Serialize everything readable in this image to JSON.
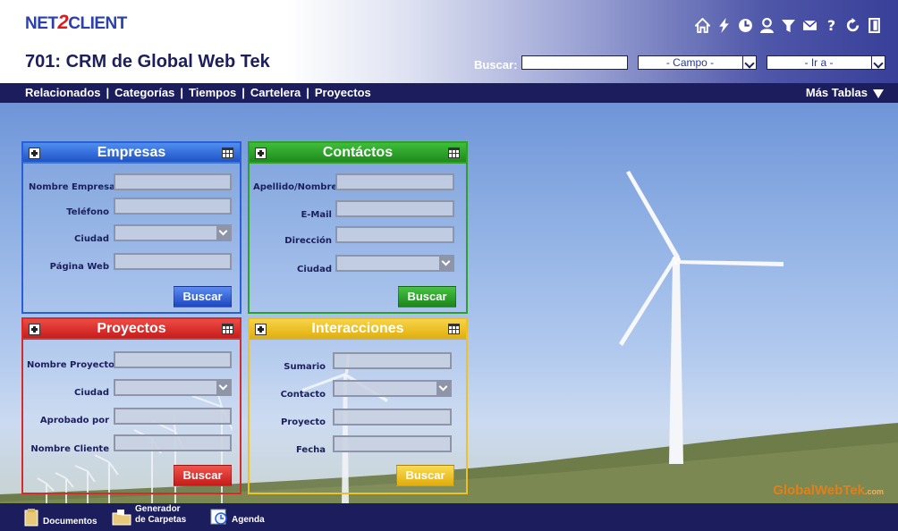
{
  "header": {
    "logo": {
      "part1": "NET",
      "part2": "2",
      "part3": "CLIENT"
    },
    "title": "701: CRM de Global Web Tek",
    "search_label": "Buscar:",
    "search_value": "",
    "campo_select": "- Campo -",
    "ira_select": "- Ir a -",
    "icons": [
      "home-icon",
      "bolt-icon",
      "clock-icon",
      "user-icon",
      "filter-icon",
      "mail-icon",
      "help-icon",
      "refresh-icon",
      "logout-icon"
    ]
  },
  "nav": {
    "links": [
      "Relacionados",
      "Categorías",
      "Tiempos",
      "Cartelera",
      "Proyectos"
    ],
    "more": "Más Tablas"
  },
  "panels": {
    "empresas": {
      "title": "Empresas",
      "fields": [
        "Nombre Empresa",
        "Teléfono",
        "Ciudad",
        "Página Web"
      ],
      "button": "Buscar"
    },
    "contactos": {
      "title": "Contáctos",
      "fields": [
        "Apellido/Nombre",
        "E-Mail",
        "Dirección",
        "Ciudad"
      ],
      "button": "Buscar"
    },
    "proyectos": {
      "title": "Proyectos",
      "fields": [
        "Nombre Proyecto",
        "Ciudad",
        "Aprobado por",
        "Nombre Cliente"
      ],
      "button": "Buscar"
    },
    "interacciones": {
      "title": "Interacciones",
      "fields": [
        "Sumario",
        "Contacto",
        "Proyecto",
        "Fecha"
      ],
      "button": "Buscar"
    }
  },
  "footer": {
    "items": [
      {
        "line1": "Documentos",
        "line2": ""
      },
      {
        "line1": "Generador",
        "line2": "de Carpetas"
      },
      {
        "line1": "Agenda",
        "line2": ""
      }
    ],
    "brand": "GlobalWebTek",
    "brand_suffix": ".com"
  },
  "colors": {
    "navy": "#1c1d5c",
    "blue": "#2a5ed4",
    "green": "#2ea12a",
    "red": "#d62b2b",
    "yellow": "#ecc12a",
    "brand": "#e0801a"
  }
}
